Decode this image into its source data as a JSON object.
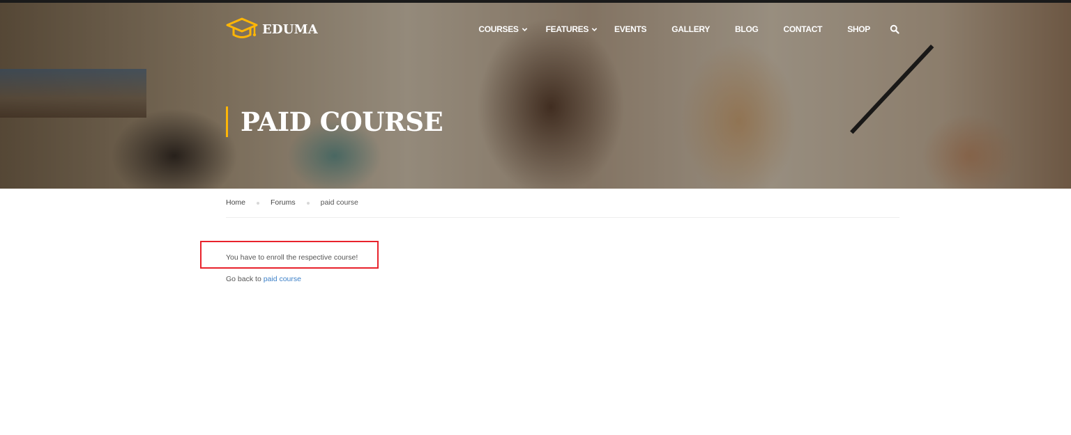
{
  "site": {
    "logo_text": "EDUMA",
    "accent_color": "#ffb606"
  },
  "nav": {
    "items": [
      {
        "label": "COURSES",
        "has_dropdown": true
      },
      {
        "label": "FEATURES",
        "has_dropdown": true
      },
      {
        "label": "EVENTS",
        "has_dropdown": false
      },
      {
        "label": "GALLERY",
        "has_dropdown": false
      },
      {
        "label": "BLOG",
        "has_dropdown": false
      },
      {
        "label": "CONTACT",
        "has_dropdown": false
      },
      {
        "label": "SHOP",
        "has_dropdown": false
      }
    ],
    "search_icon": "search-icon"
  },
  "hero": {
    "title": "PAID COURSE"
  },
  "breadcrumb": {
    "items": [
      "Home",
      "Forums",
      "paid course"
    ]
  },
  "content": {
    "notice": "You have to enroll the respective course!",
    "goback_prefix": "Go back to",
    "goback_link": "paid course",
    "link_color": "#3c80c8",
    "highlight_color": "#e8222b"
  }
}
